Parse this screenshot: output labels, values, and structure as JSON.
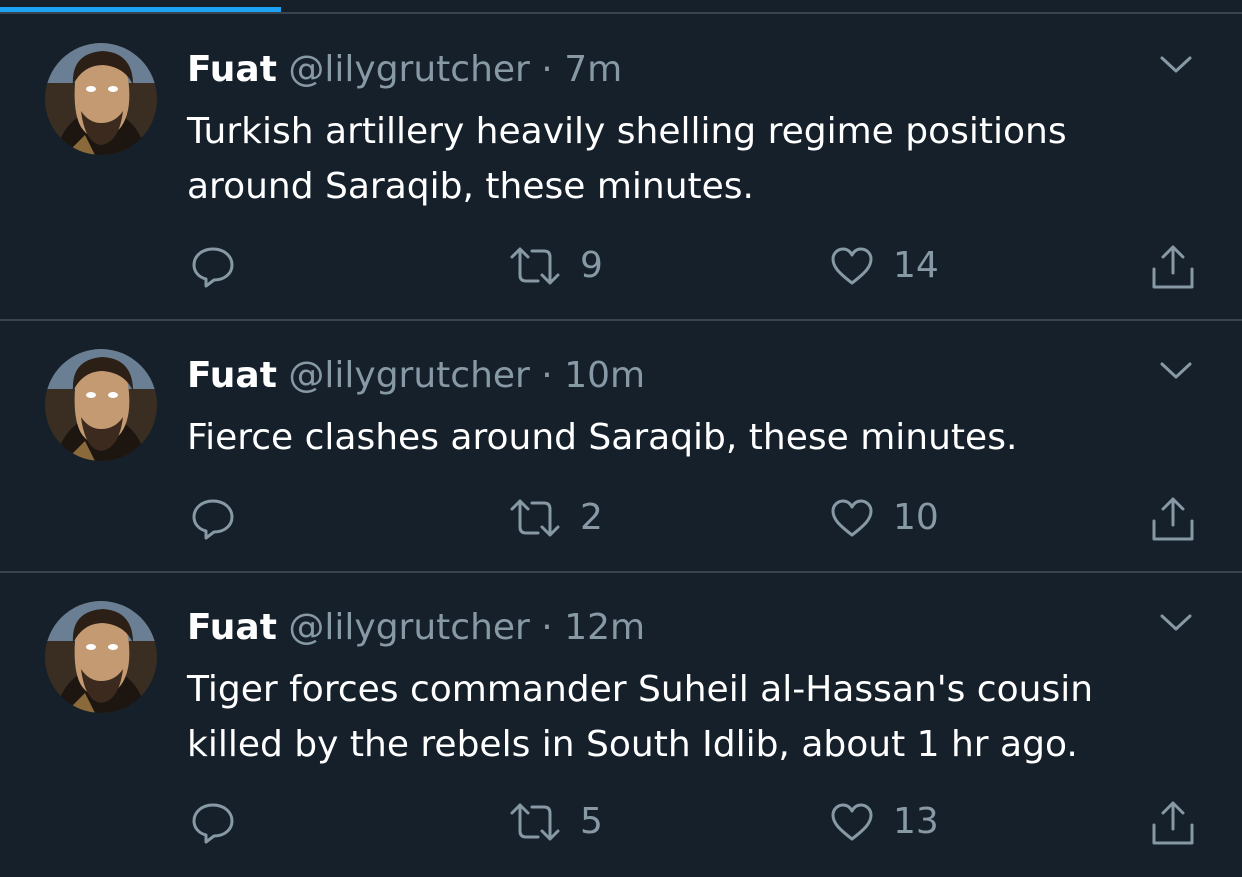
{
  "tab_indicator": {
    "progress": 0.226
  },
  "tweets": [
    {
      "name": "Fuat",
      "handle": "@lilygrutcher",
      "sep": " · ",
      "time": "7m",
      "text": "Turkish artillery heavily shelling regime positions around Saraqib, these minutes.",
      "retweets": "9",
      "likes": "14"
    },
    {
      "name": "Fuat",
      "handle": "@lilygrutcher",
      "sep": " · ",
      "time": "10m",
      "text": "Fierce clashes around Saraqib, these minutes.",
      "retweets": "2",
      "likes": "10"
    },
    {
      "name": "Fuat",
      "handle": "@lilygrutcher",
      "sep": " · ",
      "time": "12m",
      "text": "Tiger forces commander Suheil al-Hassan's cousin killed by the rebels in South Idlib, about 1 hr ago.",
      "retweets": "5",
      "likes": "13"
    }
  ],
  "icons": [
    "chevron-down-icon",
    "reply-icon",
    "retweet-icon",
    "like-icon",
    "share-icon"
  ],
  "colors": {
    "background": "#15202b",
    "accent": "#1da1f2",
    "secondary_text": "#8899a6",
    "divider": "#38444d"
  }
}
